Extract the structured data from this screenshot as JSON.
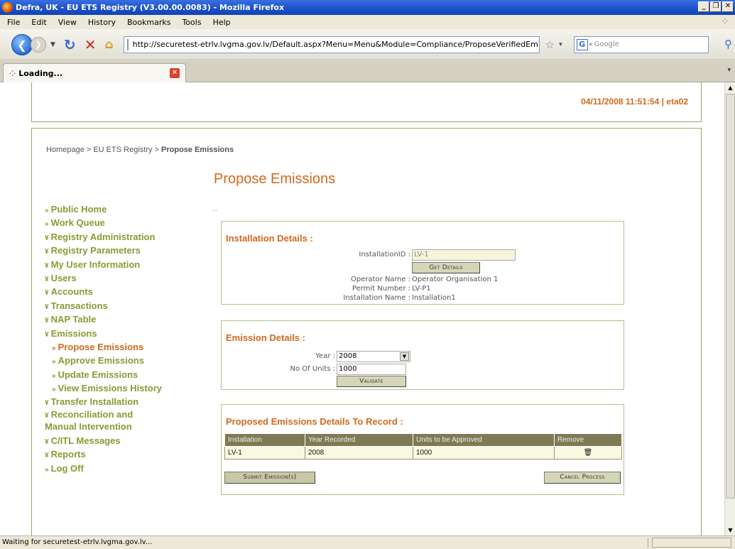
{
  "window": {
    "title": "Defra, UK - EU ETS Registry (V3.00.00.0083) - Mozilla Firefox"
  },
  "menu": [
    "File",
    "Edit",
    "View",
    "History",
    "Bookmarks",
    "Tools",
    "Help"
  ],
  "address": {
    "url": "http://securetest-etrlv.lvgma.gov.lv/Default.aspx?Menu=Menu&Module=Compliance/ProposeVerifiedEmissions"
  },
  "search": {
    "placeholder": "Google"
  },
  "tab": {
    "label": "Loading..."
  },
  "header": {
    "stamp": "04/11/2008 11:51:54 | eta02"
  },
  "breadcrumb": {
    "part1": "Homepage > EU ETS Registry > ",
    "current": "Propose Emissions"
  },
  "page": {
    "title": "Propose Emissions",
    "dots": ".."
  },
  "sidebar": {
    "items": [
      {
        "marker": "»",
        "label": "Public Home"
      },
      {
        "marker": "»",
        "label": "Work Queue"
      },
      {
        "marker": "¥",
        "label": "Registry Administration"
      },
      {
        "marker": "¥",
        "label": "Registry Parameters"
      },
      {
        "marker": "¥",
        "label": "My User Information"
      },
      {
        "marker": "¥",
        "label": "Users"
      },
      {
        "marker": "¥",
        "label": "Accounts"
      },
      {
        "marker": "¥",
        "label": "Transactions"
      },
      {
        "marker": "¥",
        "label": "NAP Table"
      },
      {
        "marker": "¥",
        "label": "Emissions"
      },
      {
        "marker": "»",
        "label": "Propose Emissions"
      },
      {
        "marker": "»",
        "label": "Approve Emissions"
      },
      {
        "marker": "»",
        "label": "Update Emissions"
      },
      {
        "marker": "»",
        "label": "View Emissions History"
      },
      {
        "marker": "¥",
        "label": "Transfer Installation"
      },
      {
        "marker": "¥",
        "label": "Reconciliation and Manual Intervention"
      },
      {
        "marker": "¥",
        "label": "C/ITL Messages"
      },
      {
        "marker": "¥",
        "label": "Reports"
      },
      {
        "marker": "»",
        "label": "Log Off"
      }
    ]
  },
  "installation": {
    "heading": "Installation Details :",
    "id_label": "InstallationID :",
    "id_value": "LV-1",
    "get_details": "Get Details",
    "operator_label": "Operator Name :",
    "operator_value": "Operator Organisation 1",
    "permit_label": "Permit Number :",
    "permit_value": "LV-P1",
    "name_label": "Installation Name :",
    "name_value": "Installation1"
  },
  "emission": {
    "heading": "Emission Details :",
    "year_label": "Year :",
    "year_value": "2008",
    "units_label": "No Of Units :",
    "units_value": "1000",
    "validate": "Validate"
  },
  "proposed": {
    "heading": "Proposed Emissions Details To Record :",
    "columns": [
      "Installation",
      "Year Recorded",
      "Units to be Approved",
      "Remove"
    ],
    "rows": [
      [
        "LV-1",
        "2008",
        "1000"
      ]
    ],
    "submit": "Submit Emission(s)",
    "cancel": "Cancel Process"
  },
  "status": {
    "text": "Waiting for securetest-etrlv.lvgma.gov.lv..."
  }
}
